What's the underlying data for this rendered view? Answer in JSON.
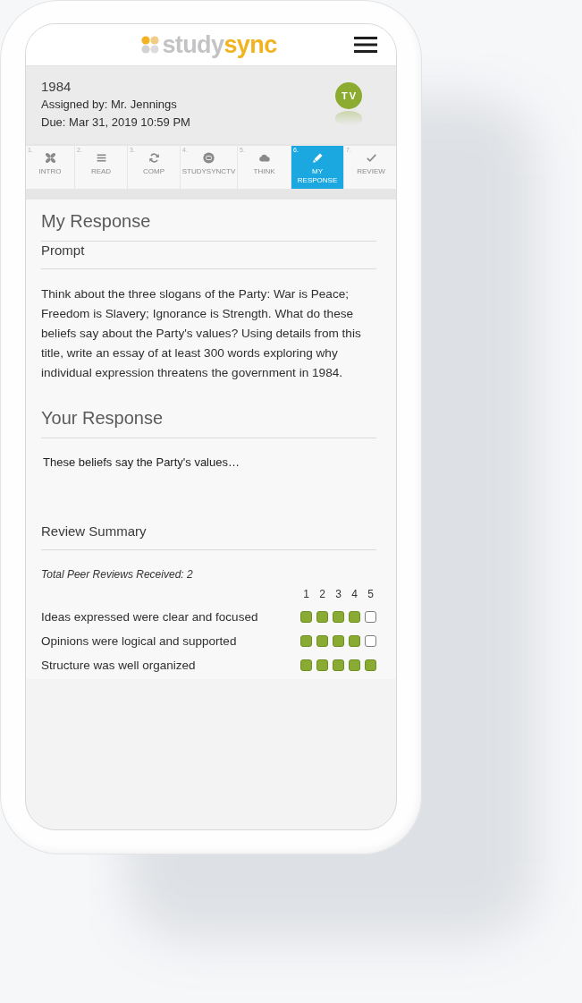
{
  "topbar": {
    "logo": {
      "text": "study",
      "accent": "sync"
    }
  },
  "assignment": {
    "title": "1984",
    "assigned_by": "Assigned by: Mr. Jennings",
    "due": "Due: Mar 31, 2019 10:59 PM",
    "badge": "TV"
  },
  "tabs": [
    {
      "number": "1.",
      "label": "INTRO",
      "kind": "intro",
      "selected": false
    },
    {
      "number": "2.",
      "label": "READ",
      "kind": "read",
      "selected": false
    },
    {
      "number": "3.",
      "label": "COMP",
      "kind": "comp",
      "selected": false
    },
    {
      "number": "4.",
      "label": "STUDYSYNCTV",
      "kind": "tv",
      "selected": false
    },
    {
      "number": "5.",
      "label": "THINK",
      "kind": "think",
      "selected": false
    },
    {
      "number": "6.",
      "label": "MY RESPONSE",
      "kind": "response",
      "selected": true
    },
    {
      "number": "7.",
      "label": "REVIEW",
      "kind": "review",
      "selected": false
    }
  ],
  "page_title": "My Response",
  "prompt": {
    "heading": "Prompt",
    "text": "Think about the three slogans of the Party: War is Peace; Freedom is Slavery; Ignorance is Strength. What do these beliefs say about the Party's values? Using details from this title, write an essay of at least 300 words exploring why individual expression threatens the government in 1984."
  },
  "your_response": {
    "heading": "Your Response",
    "text": "These beliefs say the Party's values…"
  },
  "review_summary": {
    "heading": "Review Summary",
    "total": "Total Peer Reviews Received: 2",
    "scale": [
      "1",
      "2",
      "3",
      "4",
      "5"
    ],
    "criteria": [
      {
        "label": "Ideas expressed were clear and focused",
        "stars": 4
      },
      {
        "label": "Opinions were logical and supported",
        "stars": 4
      },
      {
        "label": "Structure was well organized",
        "stars": 5
      }
    ]
  }
}
